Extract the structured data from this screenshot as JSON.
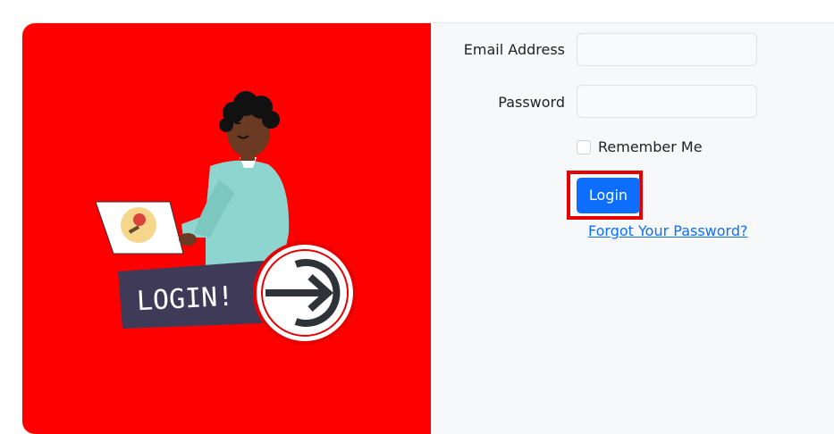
{
  "form": {
    "email_label": "Email Address",
    "email_value": "",
    "password_label": "Password",
    "password_value": "",
    "remember_label": "Remember Me",
    "login_label": "Login",
    "forgot_label": "Forgot Your Password?"
  },
  "illustration": {
    "sign_text": "LOGIN!",
    "icon": "login-arrow-icon"
  },
  "colors": {
    "left_panel_bg": "#ff0000",
    "right_panel_bg": "#f7f8fa",
    "button_bg": "#0d6efd",
    "highlight": "#e60000"
  }
}
